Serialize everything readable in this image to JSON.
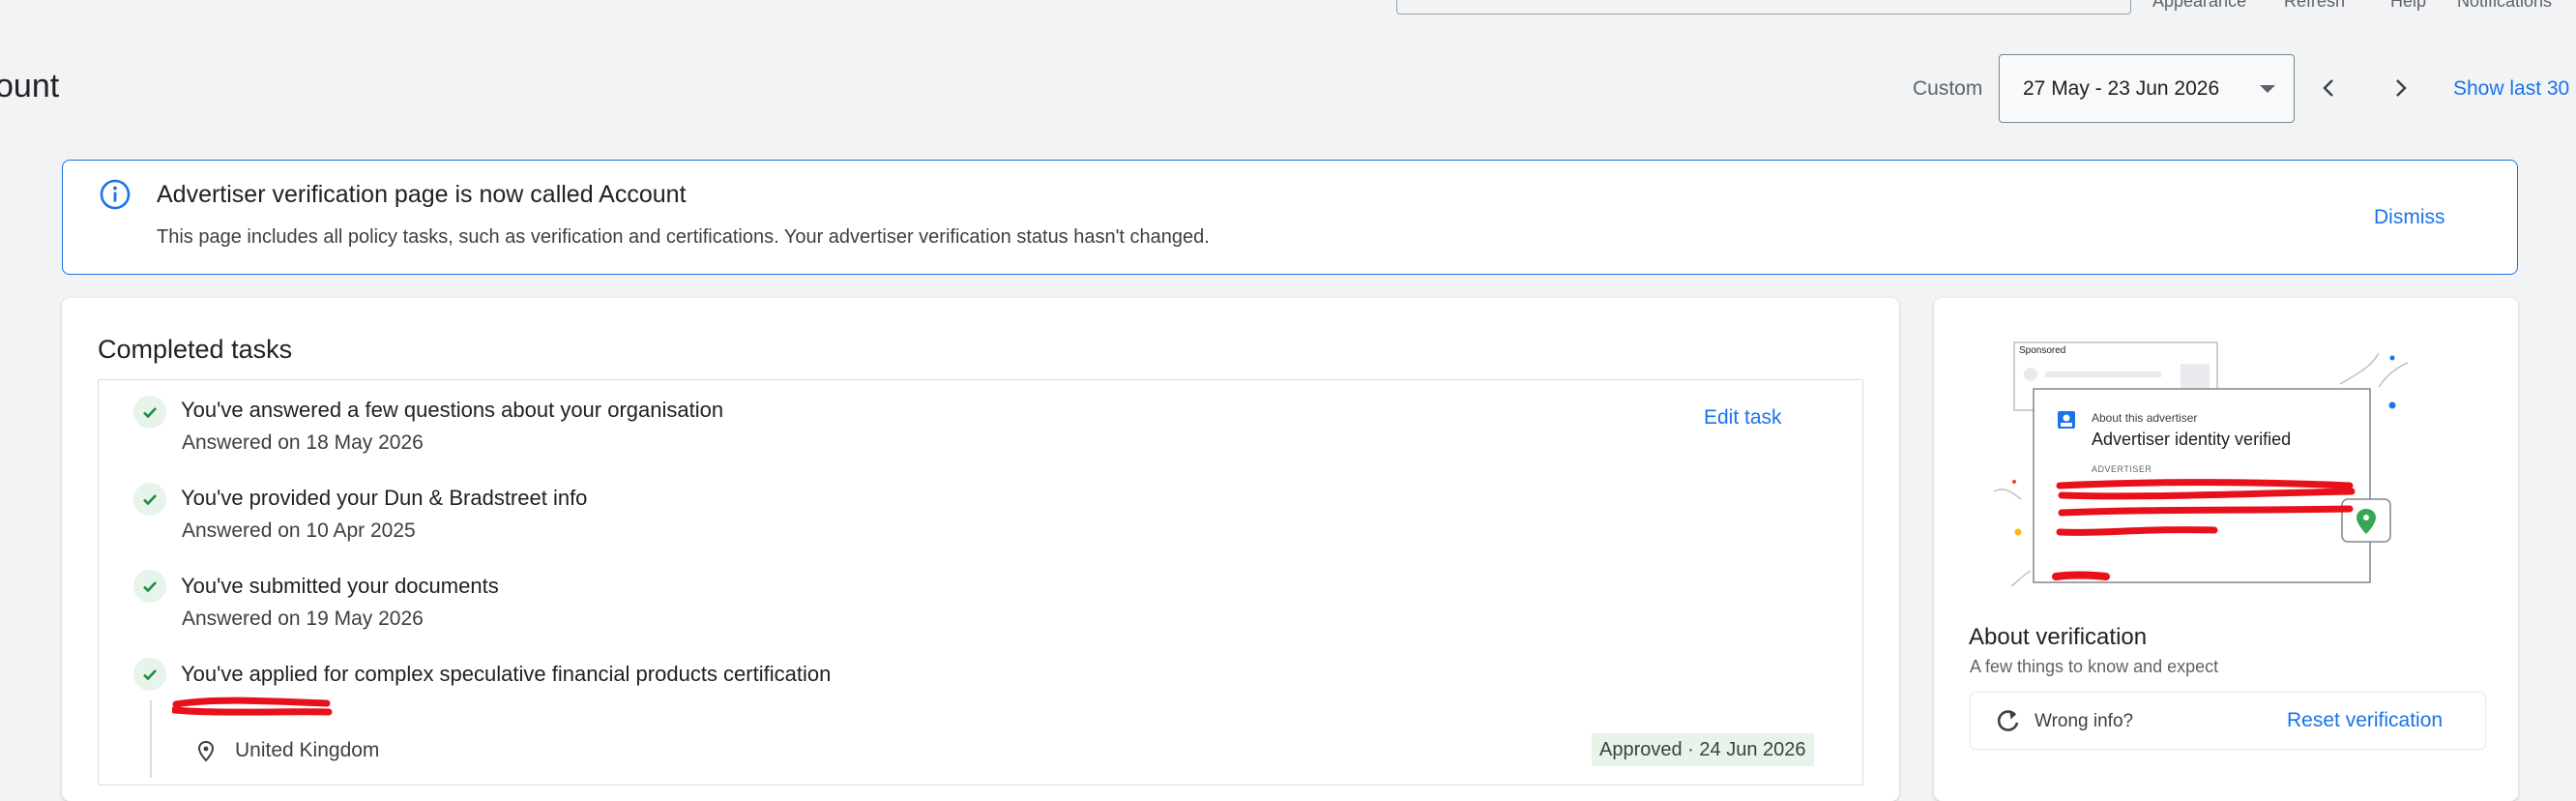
{
  "top_bar": {
    "links": [
      "Appearance",
      "Refresh",
      "Help",
      "Notifications"
    ]
  },
  "header": {
    "title": "count",
    "date_range_type": "Custom",
    "date_range_value": "27 May - 23 Jun 2026",
    "show_last": "Show last 30"
  },
  "banner": {
    "title": "Advertiser verification page is now called Account",
    "description": "This page includes all policy tasks, such as verification and certifications. Your advertiser verification status hasn't changed.",
    "dismiss": "Dismiss"
  },
  "completed_tasks": {
    "title": "Completed tasks",
    "edit_label": "Edit task",
    "tasks": [
      {
        "title": "You've answered a few questions about your organisation",
        "subtitle": "Answered on 18 May 2026"
      },
      {
        "title": "You've provided your Dun & Bradstreet info",
        "subtitle": "Answered on 10 Apr 2025"
      },
      {
        "title": "You've submitted your documents",
        "subtitle": "Answered on 19 May 2026"
      },
      {
        "title": "You've applied for complex speculative financial products certification"
      }
    ],
    "certification": {
      "country": "United Kingdom",
      "status": "Approved · 24 Jun 2026"
    }
  },
  "about_verification": {
    "illustration": {
      "sponsored": "Sponsored",
      "about_advertiser": "About this advertiser",
      "verified": "Advertiser identity verified",
      "advertiser_label": "ADVERTISER"
    },
    "title": "About verification",
    "subtitle": "A few things to know and expect",
    "wrong_info": "Wrong info?",
    "reset": "Reset verification"
  },
  "colors": {
    "accent": "#1a73e8",
    "success_bg": "#e6f4ea",
    "success": "#1e8e3e",
    "redaction": "#e8101a"
  }
}
